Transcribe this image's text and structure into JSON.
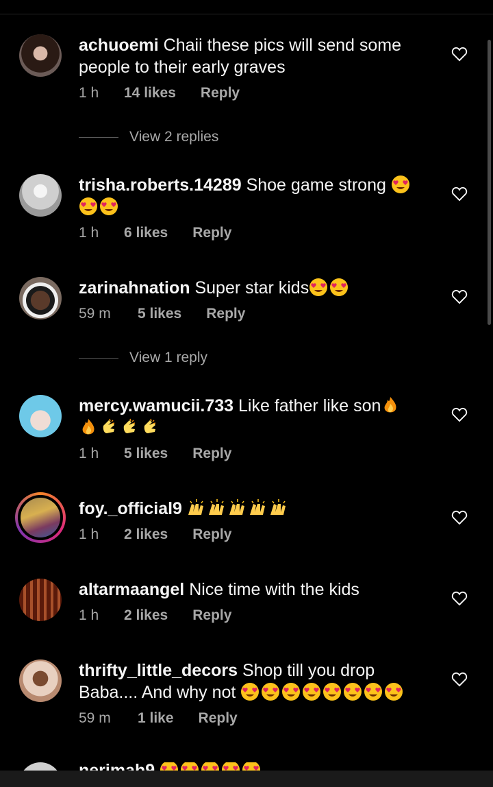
{
  "comments": [
    {
      "username": "achuoemi",
      "text": "Chaii these  pics will send some people to their early graves",
      "time": "1 h",
      "likes": "14 likes",
      "reply": "Reply",
      "avatar_color": "#6b5b57",
      "view_replies": "View 2 replies"
    },
    {
      "username": "trisha.roberts.14289",
      "text": "Shoe game strong",
      "time": "1 h",
      "likes": "6 likes",
      "reply": "Reply",
      "avatar_color": "#d9d9d9"
    },
    {
      "username": "zarinahnation",
      "text": "Super star kids",
      "time": "59 m",
      "likes": "5 likes",
      "reply": "Reply",
      "avatar_color": "#5a3a2a",
      "view_replies": "View 1 reply"
    },
    {
      "username": "mercy.wamucii.733",
      "text": "Like father like son",
      "time": "1 h",
      "likes": "5 likes",
      "reply": "Reply",
      "avatar_color": "#6ec9e8"
    },
    {
      "username": "foy._official9",
      "text": "",
      "time": "1 h",
      "likes": "2 likes",
      "reply": "Reply",
      "avatar_color": "#8a6a3a"
    },
    {
      "username": "altarmaangel",
      "text": "Nice time with the kids",
      "time": "1 h",
      "likes": "2 likes",
      "reply": "Reply",
      "avatar_color": "#7a2a1a"
    },
    {
      "username": "thrifty_little_decors",
      "text": "Shop till you drop Baba.... And why not",
      "time": "59 m",
      "likes": "1 like",
      "reply": "Reply",
      "avatar_color": "#b88a70"
    },
    {
      "username": "nerimah9",
      "text": "",
      "avatar_color": "#cfcfcf"
    }
  ],
  "colors": {
    "background": "#000000",
    "text": "#f5f5f5",
    "secondary": "#a8a8a8"
  }
}
